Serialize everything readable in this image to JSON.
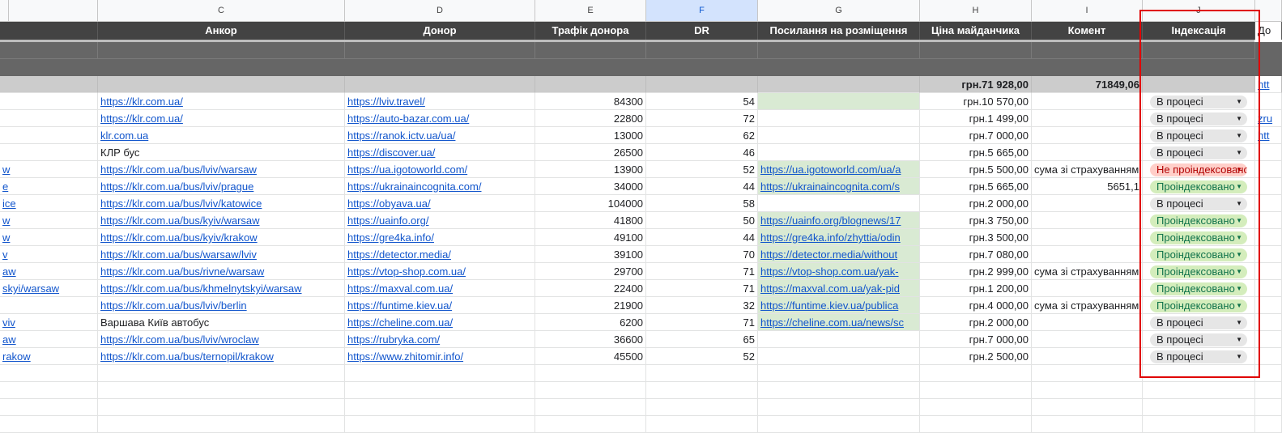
{
  "columns": {
    "c": "C",
    "d": "D",
    "e": "E",
    "f": "F",
    "g": "G",
    "h": "H",
    "i": "I",
    "j": "J"
  },
  "headers": {
    "anchor": "Анкор",
    "donor": "Донор",
    "traffic": "Трафік донора",
    "dr": "DR",
    "placement": "Посилання на розміщення",
    "price": "Ціна майданчика",
    "comment": "Комент",
    "indexation": "Індексація",
    "extra": "До"
  },
  "totals": {
    "price": "грн.71 928,00",
    "comment": "71849,06",
    "extra": "htt"
  },
  "rows": [
    {
      "b": "",
      "anchor": "https://klr.com.ua/",
      "anchor_link": true,
      "donor": "https://lviv.travel/",
      "traffic": "84300",
      "dr": "54",
      "placement": "",
      "placement_green": true,
      "price": "грн.10 570,00",
      "comment": "",
      "comment_num": false,
      "status": "В процесі",
      "status_type": "grey",
      "extra": ""
    },
    {
      "b": "",
      "anchor": "https://klr.com.ua/",
      "anchor_link": true,
      "donor": "https://auto-bazar.com.ua/",
      "traffic": "22800",
      "dr": "72",
      "placement": "",
      "placement_green": false,
      "price": "грн.1 499,00",
      "comment": "",
      "comment_num": false,
      "status": "В процесі",
      "status_type": "grey",
      "extra": "zru"
    },
    {
      "b": "",
      "anchor": "klr.com.ua",
      "anchor_link": true,
      "donor": "https://ranok.ictv.ua/ua/",
      "traffic": "13000",
      "dr": "62",
      "placement": "",
      "placement_green": false,
      "price": "грн.7 000,00",
      "comment": "",
      "comment_num": false,
      "status": "В процесі",
      "status_type": "grey",
      "extra": "htt"
    },
    {
      "b": "",
      "anchor": "КЛР бус",
      "anchor_link": false,
      "donor": "https://discover.ua/",
      "traffic": "26500",
      "dr": "46",
      "placement": "",
      "placement_green": false,
      "price": "грн.5 665,00",
      "comment": "",
      "comment_num": false,
      "status": "В процесі",
      "status_type": "grey",
      "extra": ""
    },
    {
      "b": "w",
      "anchor": "https://klr.com.ua/bus/lviv/warsaw",
      "anchor_link": true,
      "donor": "https://ua.igotoworld.com/",
      "traffic": "13900",
      "dr": "52",
      "placement": "https://ua.igotoworld.com/ua/a",
      "placement_green": true,
      "price": "грн.5 500,00",
      "comment": "сума зі страхуванням",
      "comment_num": false,
      "status": "Не проіндексовано",
      "status_type": "red",
      "extra": ""
    },
    {
      "b": "e",
      "anchor": "https://klr.com.ua/bus/lviv/prague",
      "anchor_link": true,
      "donor": "https://ukrainaincognita.com/",
      "traffic": "34000",
      "dr": "44",
      "placement": "https://ukrainaincognita.com/s",
      "placement_green": true,
      "price": "грн.5 665,00",
      "comment": "5651,1",
      "comment_num": true,
      "status": "Проіндексовано",
      "status_type": "grn",
      "extra": ""
    },
    {
      "b": "ice",
      "anchor": "https://klr.com.ua/bus/lviv/katowice",
      "anchor_link": true,
      "donor": "https://obyava.ua/",
      "traffic": "104000",
      "dr": "58",
      "placement": "",
      "placement_green": false,
      "price": "грн.2 000,00",
      "comment": "",
      "comment_num": false,
      "status": "В процесі",
      "status_type": "grey",
      "extra": ""
    },
    {
      "b": "w",
      "anchor": "https://klr.com.ua/bus/kyiv/warsaw",
      "anchor_link": true,
      "donor": "https://uainfo.org/",
      "traffic": "41800",
      "dr": "50",
      "placement": "https://uainfo.org/blognews/17",
      "placement_green": true,
      "price": "грн.3 750,00",
      "comment": "",
      "comment_num": false,
      "status": "Проіндексовано",
      "status_type": "grn",
      "extra": ""
    },
    {
      "b": "w",
      "anchor": "https://klr.com.ua/bus/kyiv/krakow",
      "anchor_link": true,
      "donor": "https://gre4ka.info/",
      "traffic": "49100",
      "dr": "44",
      "placement": "https://gre4ka.info/zhyttia/odin",
      "placement_green": true,
      "price": "грн.3 500,00",
      "comment": "",
      "comment_num": false,
      "status": "Проіндексовано",
      "status_type": "grn",
      "extra": ""
    },
    {
      "b": "v",
      "anchor": "https://klr.com.ua/bus/warsaw/lviv",
      "anchor_link": true,
      "donor": "https://detector.media/",
      "traffic": "39100",
      "dr": "70",
      "placement": "https://detector.media/without",
      "placement_green": true,
      "price": "грн.7 080,00",
      "comment": "",
      "comment_num": false,
      "status": "Проіндексовано",
      "status_type": "grn",
      "extra": ""
    },
    {
      "b": "aw",
      "anchor": "https://klr.com.ua/bus/rivne/warsaw",
      "anchor_link": true,
      "donor": "https://vtop-shop.com.ua/",
      "traffic": "29700",
      "dr": "71",
      "placement": "https://vtop-shop.com.ua/yak-",
      "placement_green": true,
      "price": "грн.2 999,00",
      "comment": "сума зі страхуванням",
      "comment_num": false,
      "status": "Проіндексовано",
      "status_type": "grn",
      "extra": ""
    },
    {
      "b": "skyi/warsaw",
      "anchor": "https://klr.com.ua/bus/khmelnytskyi/warsaw",
      "anchor_link": true,
      "donor": "https://maxval.com.ua/",
      "traffic": "22400",
      "dr": "71",
      "placement": "https://maxval.com.ua/yak-pid",
      "placement_green": true,
      "price": "грн.1 200,00",
      "comment": "",
      "comment_num": false,
      "status": "Проіндексовано",
      "status_type": "grn",
      "extra": ""
    },
    {
      "b": "",
      "anchor": "https://klr.com.ua/bus/lviv/berlin",
      "anchor_link": true,
      "donor": "https://funtime.kiev.ua/",
      "traffic": "21900",
      "dr": "32",
      "placement": "https://funtime.kiev.ua/publica",
      "placement_green": true,
      "price": "грн.4 000,00",
      "comment": "сума зі страхуванням",
      "comment_num": false,
      "status": "Проіндексовано",
      "status_type": "grn",
      "extra": ""
    },
    {
      "b": "viv",
      "anchor": "Варшава Київ автобус",
      "anchor_link": false,
      "donor": "https://cheline.com.ua/",
      "traffic": "6200",
      "dr": "71",
      "placement": "https://cheline.com.ua/news/sc",
      "placement_green": true,
      "price": "грн.2 000,00",
      "comment": "",
      "comment_num": false,
      "status": "В процесі",
      "status_type": "grey",
      "extra": ""
    },
    {
      "b": "aw",
      "anchor": "https://klr.com.ua/bus/lviv/wroclaw",
      "anchor_link": true,
      "donor": "https://rubryka.com/",
      "traffic": "36600",
      "dr": "65",
      "placement": "",
      "placement_green": false,
      "price": "грн.7 000,00",
      "comment": "",
      "comment_num": false,
      "status": "В процесі",
      "status_type": "grey",
      "extra": ""
    },
    {
      "b": "rakow",
      "anchor": "https://klr.com.ua/bus/ternopil/krakow",
      "anchor_link": true,
      "donor": "https://www.zhitomir.info/",
      "traffic": "45500",
      "dr": "52",
      "placement": "",
      "placement_green": false,
      "price": "грн.2 500,00",
      "comment": "",
      "comment_num": false,
      "status": "В процесі",
      "status_type": "grey",
      "extra": ""
    }
  ],
  "colors": {
    "header_bg": "#434343",
    "dark_band": "#666666",
    "totals_bg": "#cccccc",
    "link": "#1155cc",
    "highlight_box": "#e00000",
    "selected_column": "#d3e3fd"
  }
}
